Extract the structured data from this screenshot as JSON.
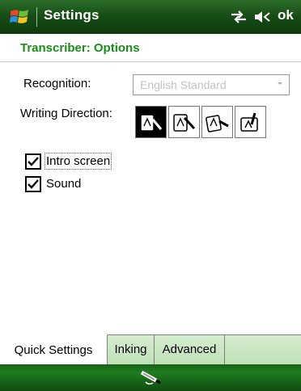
{
  "window": {
    "title": "Settings",
    "ok_label": "ok"
  },
  "page": {
    "subtitle": "Transcriber: Options"
  },
  "recognition": {
    "label": "Recognition:",
    "value": "English Standard"
  },
  "writing_direction": {
    "label": "Writing Direction:",
    "selected_index": 0,
    "options": [
      "horizontal",
      "vertical",
      "diagonal",
      "rotated"
    ]
  },
  "options": [
    {
      "label": "Intro screen",
      "checked": true
    },
    {
      "label": "Sound",
      "checked": true
    }
  ],
  "tabs": [
    {
      "label": "Quick Settings",
      "active": true
    },
    {
      "label": "Inking",
      "active": false
    },
    {
      "label": "Advanced",
      "active": false
    }
  ],
  "colors": {
    "subtitle_green": "#1a8d1a",
    "titlebar_green": "#184d17",
    "tab_green": "#c9e6c2"
  },
  "icons": {
    "start": "windows-flag-icon",
    "connectivity": "connectivity-icon",
    "volume": "speaker-off-icon",
    "input_panel": "input-panel-icon"
  }
}
